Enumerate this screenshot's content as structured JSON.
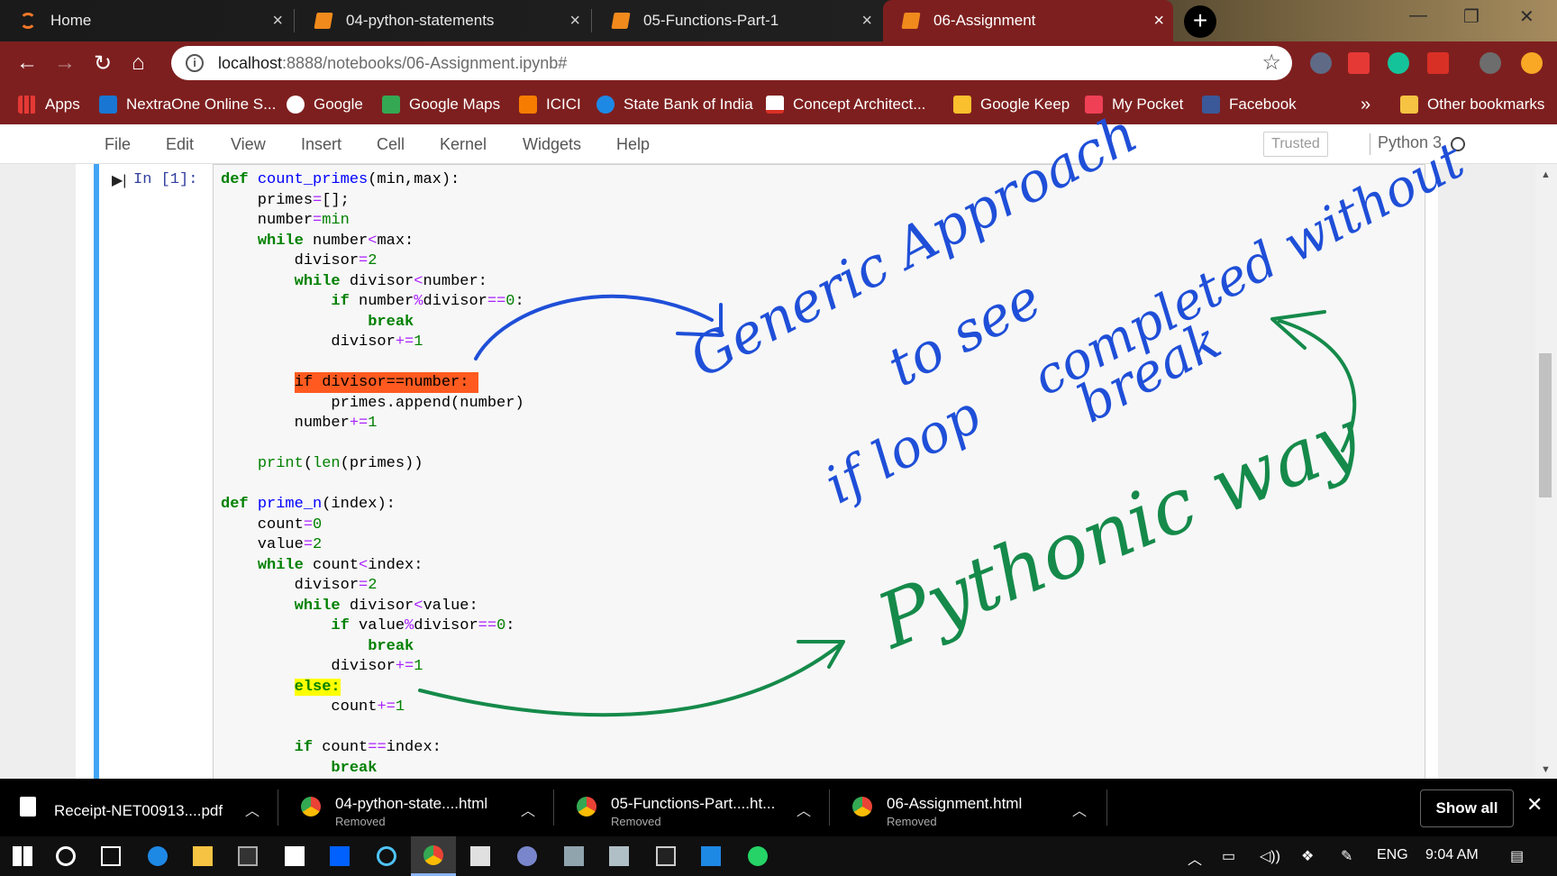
{
  "browser": {
    "tabs": [
      {
        "title": "Home",
        "icon": "jupyter-logo-icon",
        "active": false
      },
      {
        "title": "04-python-statements",
        "icon": "notebook-icon",
        "active": false
      },
      {
        "title": "05-Functions-Part-1",
        "icon": "notebook-icon",
        "active": false
      },
      {
        "title": "06-Assignment",
        "icon": "notebook-icon",
        "active": true
      }
    ],
    "new_tab": "+",
    "address": {
      "host": "localhost",
      "path": ":8888/notebooks/06-Assignment.ipynb#"
    },
    "nav": {
      "back": "←",
      "forward": "→",
      "reload": "↻",
      "home": "⌂",
      "star": "☆"
    },
    "bookmarks": [
      {
        "label": "Apps",
        "color": "#e53935"
      },
      {
        "label": "NextraOne Online S...",
        "color": "#1976d2"
      },
      {
        "label": "Google",
        "color": "#ffffff"
      },
      {
        "label": "Google Maps",
        "color": "#34a853"
      },
      {
        "label": "ICICI",
        "color": "#f57c00"
      },
      {
        "label": "State Bank of India",
        "color": "#1e88e5"
      },
      {
        "label": "Concept Architect...",
        "color": "#ffffff"
      },
      {
        "label": "Google Keep",
        "color": "#fbc02d"
      },
      {
        "label": "My Pocket",
        "color": "#ef4056"
      },
      {
        "label": "Facebook",
        "color": "#3b5998"
      }
    ],
    "bookmarks_more": "»",
    "other_bookmarks": "Other bookmarks"
  },
  "jupyter": {
    "menu": [
      "File",
      "Edit",
      "View",
      "Insert",
      "Cell",
      "Kernel",
      "Widgets",
      "Help"
    ],
    "trusted": "Trusted",
    "kernel": "Python 3",
    "prompt": "In [1]:",
    "code": [
      [
        {
          "t": "def ",
          "c": "kw"
        },
        {
          "t": "count_primes",
          "c": "fn"
        },
        {
          "t": "(min,max):"
        }
      ],
      [
        {
          "t": "    primes"
        },
        {
          "t": "=",
          "c": "op"
        },
        {
          "t": "[];"
        }
      ],
      [
        {
          "t": "    number"
        },
        {
          "t": "=",
          "c": "op"
        },
        {
          "t": "min",
          "c": "num"
        }
      ],
      [
        {
          "t": "    "
        },
        {
          "t": "while",
          "c": "kw"
        },
        {
          "t": " number"
        },
        {
          "t": "<",
          "c": "op"
        },
        {
          "t": "max:"
        }
      ],
      [
        {
          "t": "        divisor"
        },
        {
          "t": "=",
          "c": "op"
        },
        {
          "t": "2",
          "c": "num"
        }
      ],
      [
        {
          "t": "        "
        },
        {
          "t": "while",
          "c": "kw"
        },
        {
          "t": " divisor"
        },
        {
          "t": "<",
          "c": "op"
        },
        {
          "t": "number:"
        }
      ],
      [
        {
          "t": "            "
        },
        {
          "t": "if",
          "c": "kw"
        },
        {
          "t": " number"
        },
        {
          "t": "%",
          "c": "op"
        },
        {
          "t": "divisor"
        },
        {
          "t": "==",
          "c": "op"
        },
        {
          "t": "0",
          "c": "num"
        },
        {
          "t": ":"
        }
      ],
      [
        {
          "t": "                "
        },
        {
          "t": "break",
          "c": "kw"
        }
      ],
      [
        {
          "t": "            divisor"
        },
        {
          "t": "+=",
          "c": "op"
        },
        {
          "t": "1",
          "c": "num"
        }
      ],
      [
        {
          "t": ""
        }
      ],
      [
        {
          "t": "        "
        },
        {
          "t": "if divisor==number: ",
          "c": "hl-orange"
        }
      ],
      [
        {
          "t": "            primes.append(number)"
        }
      ],
      [
        {
          "t": "        number"
        },
        {
          "t": "+=",
          "c": "op"
        },
        {
          "t": "1",
          "c": "num"
        }
      ],
      [
        {
          "t": ""
        }
      ],
      [
        {
          "t": "    "
        },
        {
          "t": "print",
          "c": "num"
        },
        {
          "t": "("
        },
        {
          "t": "len",
          "c": "num"
        },
        {
          "t": "(primes))"
        }
      ],
      [
        {
          "t": ""
        }
      ],
      [
        {
          "t": "def ",
          "c": "kw"
        },
        {
          "t": "prime_n",
          "c": "fn"
        },
        {
          "t": "(index):"
        }
      ],
      [
        {
          "t": "    count"
        },
        {
          "t": "=",
          "c": "op"
        },
        {
          "t": "0",
          "c": "num"
        }
      ],
      [
        {
          "t": "    value"
        },
        {
          "t": "=",
          "c": "op"
        },
        {
          "t": "2",
          "c": "num"
        }
      ],
      [
        {
          "t": "    "
        },
        {
          "t": "while",
          "c": "kw"
        },
        {
          "t": " count"
        },
        {
          "t": "<",
          "c": "op"
        },
        {
          "t": "index:"
        }
      ],
      [
        {
          "t": "        divisor"
        },
        {
          "t": "=",
          "c": "op"
        },
        {
          "t": "2",
          "c": "num"
        }
      ],
      [
        {
          "t": "        "
        },
        {
          "t": "while",
          "c": "kw"
        },
        {
          "t": " divisor"
        },
        {
          "t": "<",
          "c": "op"
        },
        {
          "t": "value:"
        }
      ],
      [
        {
          "t": "            "
        },
        {
          "t": "if",
          "c": "kw"
        },
        {
          "t": " value"
        },
        {
          "t": "%",
          "c": "op"
        },
        {
          "t": "divisor"
        },
        {
          "t": "==",
          "c": "op"
        },
        {
          "t": "0",
          "c": "num"
        },
        {
          "t": ":"
        }
      ],
      [
        {
          "t": "                "
        },
        {
          "t": "break",
          "c": "kw"
        }
      ],
      [
        {
          "t": "            divisor"
        },
        {
          "t": "+=",
          "c": "op"
        },
        {
          "t": "1",
          "c": "num"
        }
      ],
      [
        {
          "t": "        "
        },
        {
          "t": "else:",
          "c": "hl-yellow kw"
        }
      ],
      [
        {
          "t": "            count"
        },
        {
          "t": "+=",
          "c": "op"
        },
        {
          "t": "1",
          "c": "num"
        }
      ],
      [
        {
          "t": ""
        }
      ],
      [
        {
          "t": "        "
        },
        {
          "t": "if",
          "c": "kw"
        },
        {
          "t": " count"
        },
        {
          "t": "==",
          "c": "op"
        },
        {
          "t": "index:"
        }
      ],
      [
        {
          "t": "            "
        },
        {
          "t": "break",
          "c": "kw"
        }
      ]
    ]
  },
  "annotations": {
    "blue_note": "Generic Approach to see if loop completed without break",
    "green_note": "Pythonic way",
    "blue_color": "#1f4fd8",
    "green_color": "#158a4a"
  },
  "downloads": [
    {
      "name": "Receipt-NET00913....pdf",
      "status": "",
      "icon": "pdf-file-icon"
    },
    {
      "name": "04-python-state....html",
      "status": "Removed",
      "icon": "chrome-icon"
    },
    {
      "name": "05-Functions-Part....ht...",
      "status": "Removed",
      "icon": "chrome-icon"
    },
    {
      "name": "06-Assignment.html",
      "status": "Removed",
      "icon": "chrome-icon"
    }
  ],
  "downloads_show_all": "Show all",
  "downloads_close": "✕",
  "taskbar": {
    "language": "ENG",
    "time": "9:04 AM"
  }
}
